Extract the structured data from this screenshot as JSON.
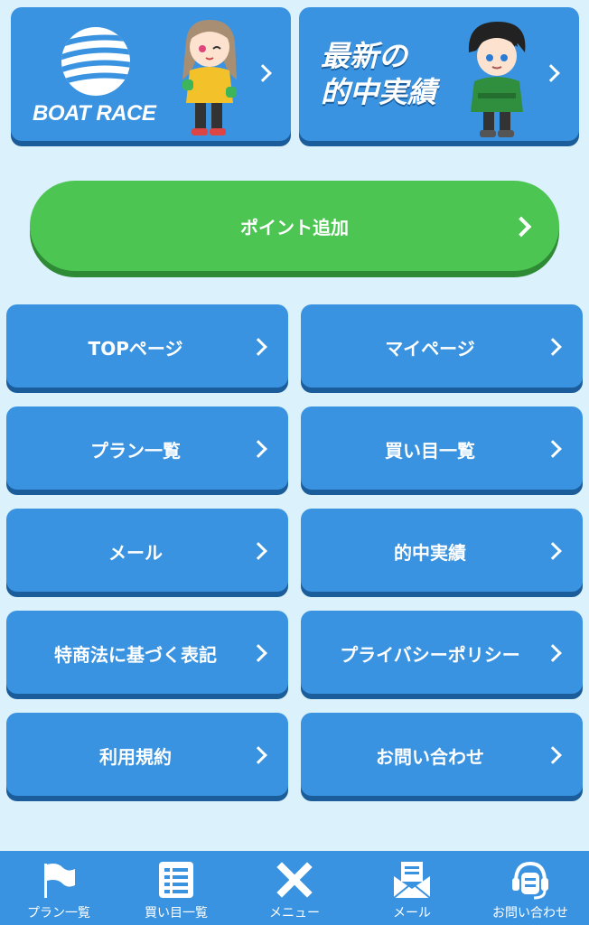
{
  "banners": {
    "boatrace": {
      "logo_text": "BOAT RACE"
    },
    "hits": {
      "line1": "最新の",
      "line2": "的中実績"
    }
  },
  "point_button": {
    "label": "ポイント追加"
  },
  "menu": {
    "top": "TOPページ",
    "mypage": "マイページ",
    "plans": "プラン一覧",
    "picks": "買い目一覧",
    "mail": "メール",
    "hits": "的中実績",
    "tokusho": "特商法に基づく表記",
    "privacy": "プライバシーポリシー",
    "terms": "利用規約",
    "contact": "お問い合わせ"
  },
  "bottom_nav": {
    "plans": {
      "label": "プラン一覧",
      "icon": "flag-icon"
    },
    "picks": {
      "label": "買い目一覧",
      "icon": "list-icon"
    },
    "menu": {
      "label": "メニュー",
      "icon": "close-icon"
    },
    "mail": {
      "label": "メール",
      "icon": "mail-icon"
    },
    "contact": {
      "label": "お問い合わせ",
      "icon": "headset-icon"
    }
  },
  "colors": {
    "background": "#dbf1fb",
    "button_blue": "#3a93e0",
    "button_shadow": "#1b5c9a",
    "point_green": "#4cc552"
  }
}
